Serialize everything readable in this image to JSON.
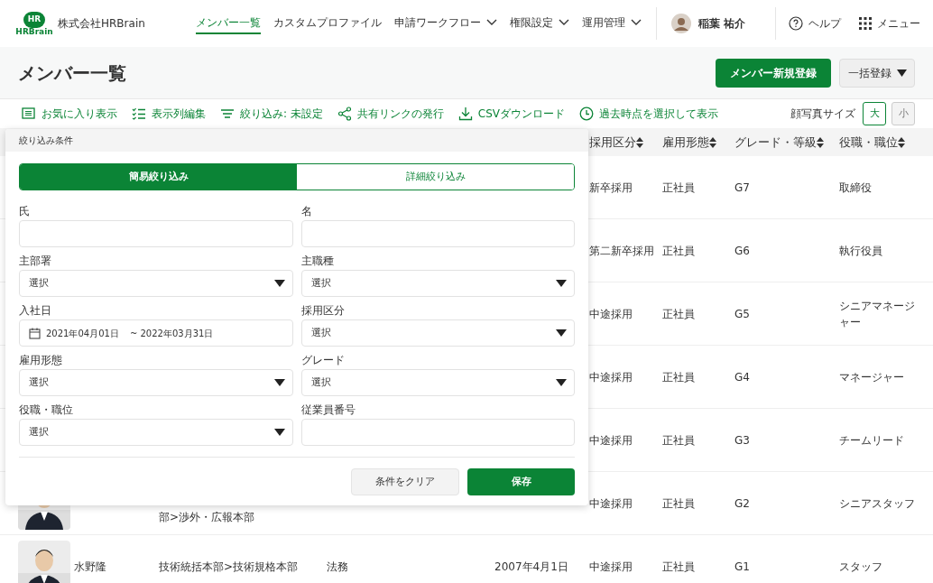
{
  "header": {
    "logo_mark": "HR",
    "logo_sub": "HRBrain",
    "company": "株式会社HRBrain",
    "nav": [
      {
        "label": "メンバー一覧",
        "selected": true,
        "dropdown": false
      },
      {
        "label": "カスタムプロファイル",
        "selected": false,
        "dropdown": false
      },
      {
        "label": "申請ワークフロー",
        "selected": false,
        "dropdown": true
      },
      {
        "label": "権限設定",
        "selected": false,
        "dropdown": true
      },
      {
        "label": "運用管理",
        "selected": false,
        "dropdown": true
      }
    ],
    "user": {
      "name": "稲葉 祐介"
    },
    "help": "ヘルプ",
    "menu": "メニュー"
  },
  "page": {
    "title": "メンバー一覧",
    "primary_button": "メンバー新規登録",
    "secondary_button": "一括登録"
  },
  "toolbar": {
    "actions": [
      {
        "kind": "list",
        "label": "お気に入り表示"
      },
      {
        "kind": "checklist",
        "label": "表示列編集"
      },
      {
        "kind": "filter",
        "label": "絞り込み: 未設定"
      },
      {
        "kind": "share",
        "label": "共有リンクの発行"
      },
      {
        "kind": "download",
        "label": "CSVダウンロード"
      },
      {
        "kind": "clock",
        "label": "過去時点を選択して表示"
      }
    ],
    "photo_size_label": "顔写真サイズ",
    "sizes": [
      {
        "label": "大",
        "selected": true
      },
      {
        "label": "小",
        "selected": false
      }
    ]
  },
  "table": {
    "columns": [
      "採用区分",
      "雇用形態",
      "グレード・等級",
      "役職・職位"
    ],
    "rows": [
      {
        "hire": "新卒採用",
        "employment": "正社員",
        "grade": "G7",
        "position": "取締役"
      },
      {
        "hire": "第二新卒採用",
        "employment": "正社員",
        "grade": "G6",
        "position": "執行役員"
      },
      {
        "hire": "中途採用",
        "employment": "正社員",
        "grade": "G5",
        "position": "シニアマネージャー"
      },
      {
        "hire": "中途採用",
        "employment": "正社員",
        "grade": "G4",
        "position": "マネージャー"
      },
      {
        "hire": "中途採用",
        "employment": "正社員",
        "grade": "G3",
        "position": "チームリード"
      },
      {
        "photo": true,
        "department": "部>渉外・広報本部",
        "department_partial": true,
        "hire": "中途採用",
        "employment": "正社員",
        "grade": "G2",
        "position": "シニアスタッフ"
      },
      {
        "photo": true,
        "name": "水野隆",
        "department": "技術統括本部>技術規格本部",
        "job": "法務",
        "joined": "2007年4月1日",
        "hire": "中途採用",
        "employment": "正社員",
        "grade": "G1",
        "position": "スタッフ"
      }
    ]
  },
  "filter_panel": {
    "title": "絞り込み条件",
    "tabs": [
      {
        "label": "簡易絞り込み",
        "selected": true
      },
      {
        "label": "詳細絞り込み",
        "selected": false
      }
    ],
    "fields": [
      {
        "kind": "text",
        "label": "氏"
      },
      {
        "kind": "text",
        "label": "名"
      },
      {
        "kind": "select",
        "label": "主部署",
        "value": "選択"
      },
      {
        "kind": "select",
        "label": "主職種",
        "value": "選択"
      },
      {
        "kind": "date_range",
        "label": "入社日",
        "start": "2021年04月01日",
        "end": "~ 2022年03月31日"
      },
      {
        "kind": "select",
        "label": "採用区分",
        "value": "選択"
      },
      {
        "kind": "select",
        "label": "雇用形態",
        "value": "選択"
      },
      {
        "kind": "select",
        "label": "グレード",
        "value": "選択"
      },
      {
        "kind": "select",
        "label": "役職・職位",
        "value": "選択"
      },
      {
        "kind": "text",
        "label": "従業員番号"
      }
    ],
    "clear_button": "条件をクリア",
    "save_button": "保存"
  }
}
